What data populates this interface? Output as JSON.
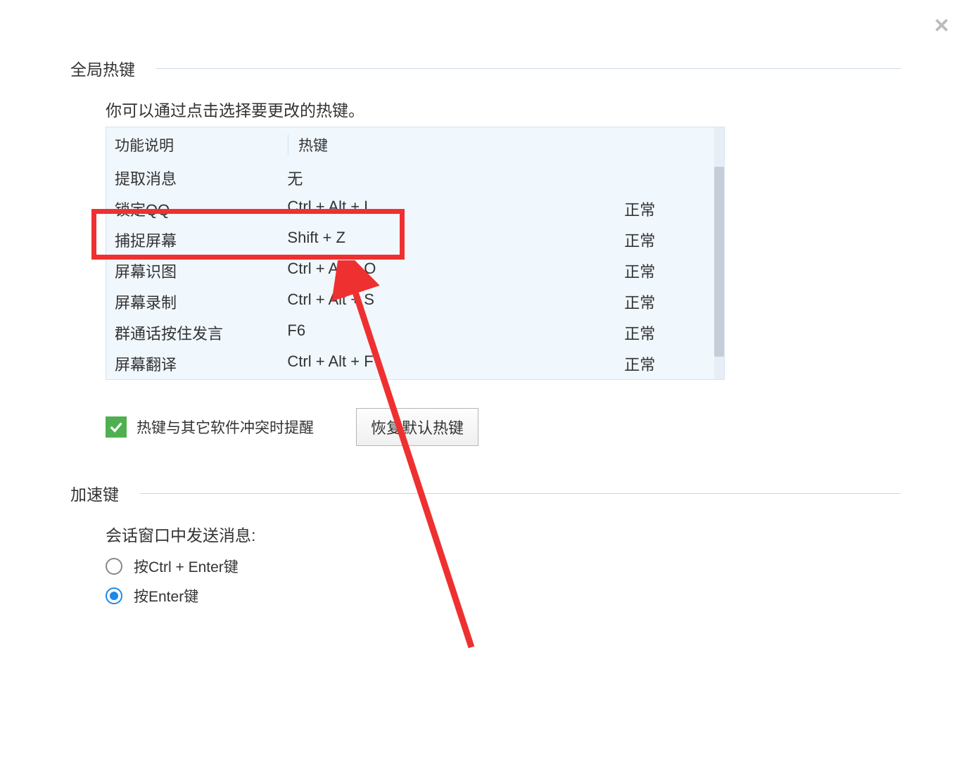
{
  "close_icon_glyph": "✕",
  "section_hotkey": {
    "title": "全局热键",
    "instruction": "你可以通过点击选择要更改的热键。",
    "columns": {
      "func": "功能说明",
      "hotkey": "热键"
    },
    "rows": [
      {
        "func": "提取消息",
        "hotkey": "无",
        "status": ""
      },
      {
        "func": "锁定QQ",
        "hotkey": "Ctrl + Alt + L",
        "status": "正常"
      },
      {
        "func": "捕捉屏幕",
        "hotkey": "Shift + Z",
        "status": "正常"
      },
      {
        "func": "屏幕识图",
        "hotkey": "Ctrl + Alt + O",
        "status": "正常"
      },
      {
        "func": "屏幕录制",
        "hotkey": "Ctrl + Alt + S",
        "status": "正常"
      },
      {
        "func": "群通话按住发言",
        "hotkey": "F6",
        "status": "正常"
      },
      {
        "func": "屏幕翻译",
        "hotkey": "Ctrl + Alt + F",
        "status": "正常"
      }
    ],
    "conflict_checkbox_label": "热键与其它软件冲突时提醒",
    "restore_button": "恢复默认热键"
  },
  "section_accel": {
    "title": "加速键",
    "send_label": "会话窗口中发送消息:",
    "options": [
      {
        "label": "按Ctrl + Enter键",
        "checked": false
      },
      {
        "label": "按Enter键",
        "checked": true
      }
    ]
  }
}
